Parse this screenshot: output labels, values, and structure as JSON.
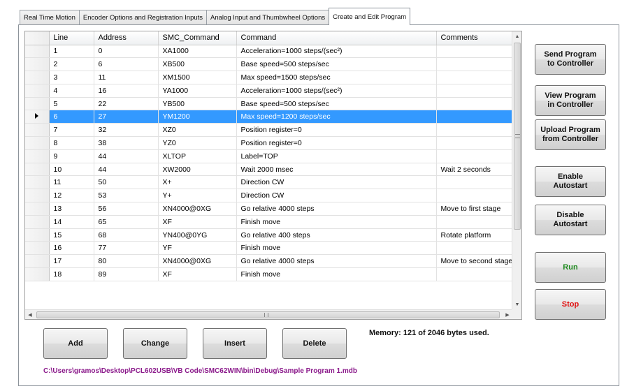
{
  "tabs": [
    "Real Time Motion",
    "Encoder Options and Registration Inputs",
    "Analog Input and Thumbwheel Options",
    "Create and Edit Program"
  ],
  "active_tab_index": 3,
  "grid": {
    "columns": [
      "Line",
      "Address",
      "SMC_Command",
      "Command",
      "Comments"
    ],
    "selected_row_index": 5,
    "rows": [
      [
        "1",
        "0",
        "XA1000",
        "Acceleration=1000 steps/(sec²)",
        ""
      ],
      [
        "2",
        "6",
        "XB500",
        "Base speed=500 steps/sec",
        ""
      ],
      [
        "3",
        "11",
        "XM1500",
        "Max speed=1500 steps/sec",
        ""
      ],
      [
        "4",
        "16",
        "YA1000",
        "Acceleration=1000 steps/(sec²)",
        ""
      ],
      [
        "5",
        "22",
        "YB500",
        "Base speed=500 steps/sec",
        ""
      ],
      [
        "6",
        "27",
        "YM1200",
        "Max speed=1200 steps/sec",
        ""
      ],
      [
        "7",
        "32",
        "XZ0",
        "Position register=0",
        ""
      ],
      [
        "8",
        "38",
        "YZ0",
        "Position register=0",
        ""
      ],
      [
        "9",
        "44",
        "XLTOP",
        "Label=TOP",
        ""
      ],
      [
        "10",
        "44",
        "XW2000",
        "Wait 2000 msec",
        "Wait 2 seconds"
      ],
      [
        "11",
        "50",
        "X+",
        "Direction CW",
        ""
      ],
      [
        "12",
        "53",
        "Y+",
        "Direction CW",
        ""
      ],
      [
        "13",
        "56",
        "XN4000@0XG",
        "Go relative 4000 steps",
        "Move to first stage"
      ],
      [
        "14",
        "65",
        "XF",
        "Finish move",
        ""
      ],
      [
        "15",
        "68",
        "YN400@0YG",
        "Go relative 400 steps",
        "Rotate platform"
      ],
      [
        "16",
        "77",
        "YF",
        "Finish move",
        ""
      ],
      [
        "17",
        "80",
        "XN4000@0XG",
        "Go relative 4000 steps",
        "Move to second stage"
      ],
      [
        "18",
        "89",
        "XF",
        "Finish move",
        ""
      ]
    ]
  },
  "side_buttons": {
    "send": "Send Program\nto Controller",
    "view": "View Program\nin Controller",
    "upload": "Upload Program\nfrom Controller",
    "enable": "Enable\nAutostart",
    "disable": "Disable\nAutostart",
    "run": "Run",
    "stop": "Stop"
  },
  "bottom_buttons": {
    "add": "Add",
    "change": "Change",
    "insert": "Insert",
    "delete": "Delete"
  },
  "memory_text": "Memory: 121 of 2046 bytes used.",
  "file_path": "C:\\Users\\gramos\\Desktop\\PCL602USB\\VB Code\\SMC62WIN\\bin\\Debug\\Sample Program 1.mdb",
  "colors": {
    "selection": "#3399ff",
    "run_text": "#1f8a1f",
    "stop_text": "#e01010",
    "path_text": "#8b1a8b"
  }
}
